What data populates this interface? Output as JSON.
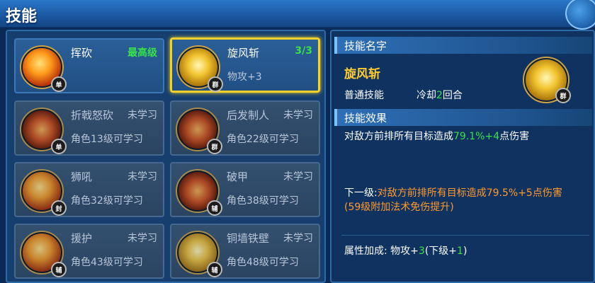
{
  "header": {
    "title": "技能"
  },
  "skills": [
    {
      "name": "挥砍",
      "status": "最高级",
      "sub": "",
      "tag": "单"
    },
    {
      "name": "旋风斩",
      "status": "3/3",
      "sub": "物攻+3",
      "tag": "群"
    },
    {
      "name": "折戟怒砍",
      "status": "未学习",
      "sub": "角色13级可学习",
      "tag": "单"
    },
    {
      "name": "后发制人",
      "status": "未学习",
      "sub": "角色22级可学习",
      "tag": "群"
    },
    {
      "name": "狮吼",
      "status": "未学习",
      "sub": "角色32级可学习",
      "tag": "封"
    },
    {
      "name": "破甲",
      "status": "未学习",
      "sub": "角色38级可学习",
      "tag": "辅"
    },
    {
      "name": "援护",
      "status": "未学习",
      "sub": "角色43级可学习",
      "tag": "辅"
    },
    {
      "name": "铜墙铁壁",
      "status": "未学习",
      "sub": "角色48级可学习",
      "tag": "辅"
    }
  ],
  "detail": {
    "name_header": "技能名字",
    "skill_name": "旋风斩",
    "type": "普通技能",
    "cooldown_prefix": "冷却",
    "cooldown_value": "2",
    "cooldown_suffix": "回合",
    "tag": "群",
    "effect_header": "技能效果",
    "effect_prefix": "对敌方前排所有目标造成",
    "effect_value": "79.1%+4",
    "effect_suffix": "点伤害",
    "next_label": "下一级:",
    "next_text": "对敌方前排所有目标造成79.5%+5点伤害",
    "next_note": "(59级附加法术免伤提升)",
    "bonus_label": "属性加成:",
    "bonus_prefix": "物攻+",
    "bonus_value": "3",
    "bonus_mid": "(下级+",
    "bonus_next": "1",
    "bonus_end": ")"
  }
}
